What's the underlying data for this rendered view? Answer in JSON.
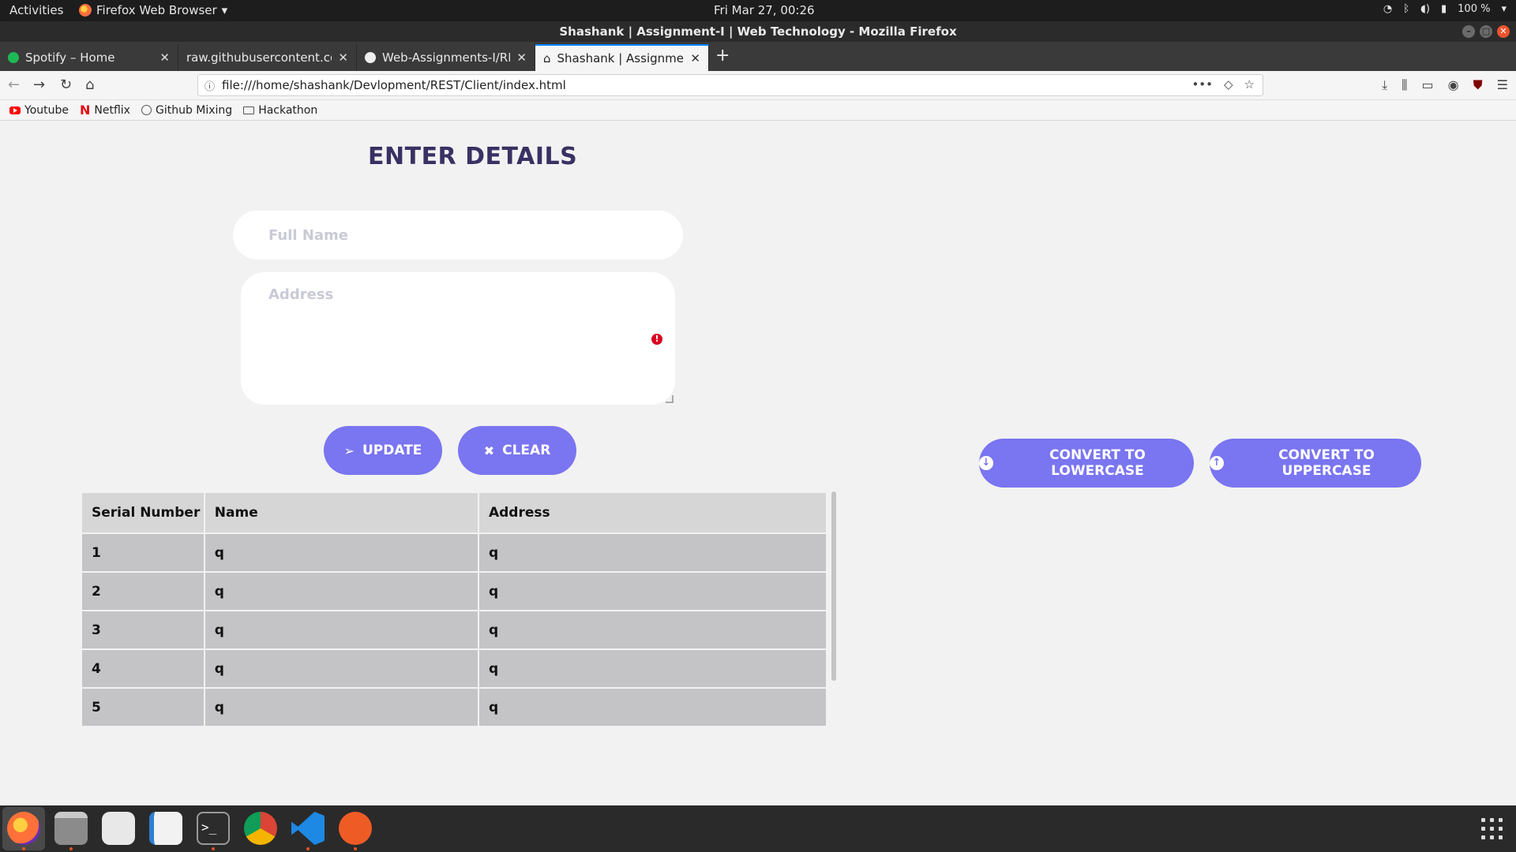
{
  "system": {
    "activities": "Activities",
    "app_name": "Firefox Web Browser",
    "clock": "Fri Mar 27, 00:26",
    "battery": "100 %"
  },
  "window": {
    "title": "Shashank | Assignment-I | Web Technology - Mozilla Firefox"
  },
  "tabs": [
    {
      "label": "Spotify – Home",
      "icon": "spotify-icon"
    },
    {
      "label": "raw.githubusercontent.com",
      "icon": "none"
    },
    {
      "label": "Web-Assignments-I/REA",
      "icon": "github-icon"
    },
    {
      "label": "Shashank | Assignment-I",
      "icon": "home-icon",
      "active": true
    }
  ],
  "navbar": {
    "url": "file:///home/shashank/Devlopment/REST/Client/index.html"
  },
  "bookmarks": [
    {
      "label": "Youtube",
      "icon": "youtube-icon"
    },
    {
      "label": "Netflix",
      "icon": "netflix-icon"
    },
    {
      "label": "Github Mixing",
      "icon": "globe-icon"
    },
    {
      "label": "Hackathon",
      "icon": "folder-icon"
    }
  ],
  "form": {
    "heading": "ENTER DETAILS",
    "name_placeholder": "Full Name",
    "name_value": "",
    "address_placeholder": "Address",
    "address_value": "",
    "update_label": "UPDATE",
    "clear_label": "CLEAR"
  },
  "actions": {
    "lowercase_label": "CONVERT TO LOWERCASE",
    "uppercase_label": "CONVERT TO UPPERCASE"
  },
  "table": {
    "headers": [
      "Serial Number",
      "Name",
      "Address"
    ],
    "rows": [
      [
        "1",
        "q",
        "q"
      ],
      [
        "2",
        "q",
        "q"
      ],
      [
        "3",
        "q",
        "q"
      ],
      [
        "4",
        "q",
        "q"
      ],
      [
        "5",
        "q",
        "q"
      ]
    ]
  },
  "colors": {
    "accent": "#7a75f0",
    "heading": "#3a3163",
    "page_bg": "#f2f2f2",
    "table_cell": "#c4c4c6"
  },
  "dock": [
    "firefox-icon",
    "files-icon",
    "rhythmbox-icon",
    "writer-icon",
    "terminal-icon",
    "chrome-icon",
    "vscode-icon",
    "postman-icon"
  ]
}
